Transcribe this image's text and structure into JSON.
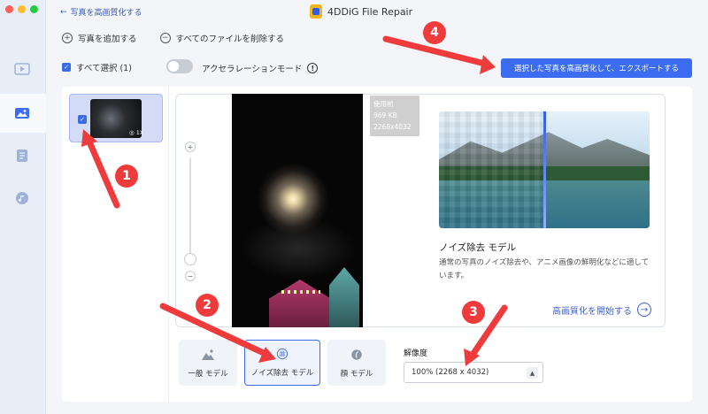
{
  "window": {
    "title": "4DDiG File Repair",
    "back_label": "写真を高画質化する",
    "traffic_colors": [
      "#ff5f57",
      "#febc2e",
      "#28c840"
    ]
  },
  "sidebar": {
    "items": [
      {
        "icon": "video-icon"
      },
      {
        "icon": "photo-icon",
        "active": true
      },
      {
        "icon": "document-icon"
      },
      {
        "icon": "music-icon"
      }
    ]
  },
  "actions": {
    "add_photo": "写真を追加する",
    "delete_all": "すべてのファイルを削除する"
  },
  "selection": {
    "select_all": "すべて選択 (1)",
    "acceleration_mode": "アクセラレーションモード",
    "acceleration_enabled": false,
    "export_button": "選択した写真を高画質化して、エクスポートする"
  },
  "thumbnail": {
    "checked": true,
    "badge": "◎ 1X"
  },
  "preview": {
    "info_lines": [
      "使用前",
      "969 KB",
      "2268x4032"
    ],
    "zoom_in": "+",
    "zoom_out": "−"
  },
  "model_panel": {
    "title": "ノイズ除去 モデル",
    "description": "通常の写真のノイズ除去や、アニメ画像の鮮明化などに適しています。",
    "start_link": "高画質化を開始する"
  },
  "modes": [
    {
      "label": "一般 モデル",
      "icon": "mountain-icon",
      "active": false
    },
    {
      "label": "ノイズ除去 モデル",
      "icon": "noise-icon",
      "active": true
    },
    {
      "label": "顔 モデル",
      "icon": "face-icon",
      "active": false
    }
  ],
  "resolution": {
    "label": "解像度",
    "value": "100% (2268 x 4032)"
  },
  "annotations": {
    "steps": [
      "1",
      "2",
      "3",
      "4"
    ],
    "color": "#ef3b3b"
  },
  "colors": {
    "accent": "#3c6df0"
  }
}
